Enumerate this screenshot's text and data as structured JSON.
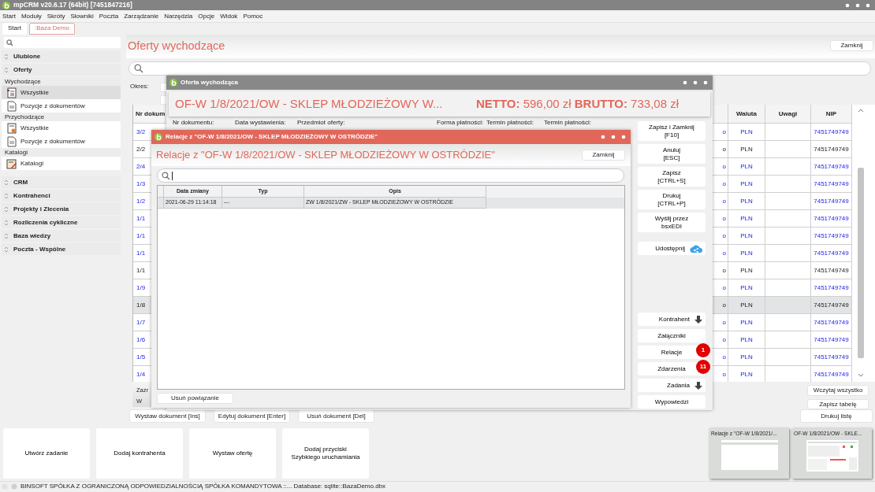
{
  "app": {
    "title": "mpCRM v20.6.17 (64bit) [7451847216]"
  },
  "menu": [
    "Start",
    "Moduły",
    "Skróty",
    "Słowniki",
    "Poczta",
    "Zarządzanie",
    "Narzędzia",
    "Opcje",
    "Widok",
    "Pomoc"
  ],
  "tabs": [
    {
      "label": "Start",
      "selected": false
    },
    {
      "label": ":Baza Demo",
      "selected": true
    }
  ],
  "sidebar": {
    "sections": [
      {
        "label": "Ulubione"
      },
      {
        "label": "Oferty",
        "groups": [
          {
            "label": "Wychodzące",
            "items": [
              {
                "label": "Wszystkie",
                "kind": "list",
                "selected": true
              },
              {
                "label": "Pozycje z dokumentów",
                "kind": "document",
                "selected": false
              }
            ]
          },
          {
            "label": "Przychodzące",
            "items": [
              {
                "label": "Wszystkie",
                "kind": "incoming",
                "selected": false
              },
              {
                "label": "Pozycje z dokumentów",
                "kind": "document",
                "selected": false
              }
            ]
          },
          {
            "label": "Katalogi",
            "items": [
              {
                "label": "Katalogi",
                "kind": "catalog",
                "selected": false
              }
            ]
          }
        ]
      },
      {
        "label": "CRM"
      },
      {
        "label": "Kontrahenci"
      },
      {
        "label": "Projekty i Zlecenia"
      },
      {
        "label": "Rozliczenia cykliczne"
      },
      {
        "label": "Baza wiedzy"
      },
      {
        "label": "Poczta - Wspólne"
      }
    ]
  },
  "content": {
    "title": "Oferty wychodzące",
    "close_button": "Zamknij",
    "period_label": "Okres:",
    "table": {
      "columns": [
        "Nr dokum",
        "Waluta",
        "Uwagi",
        "NIP"
      ],
      "rows": [
        {
          "nr": "3/2",
          "column_2": "o",
          "waluta": "PLN",
          "nip": "7451749749",
          "kind": "link",
          "selected": false
        },
        {
          "nr": "2/2",
          "column_2": "o",
          "waluta": "PLN",
          "nip": "7451749749",
          "kind": "plain",
          "selected": false
        },
        {
          "nr": "2/4",
          "column_2": "o",
          "waluta": "PLN",
          "nip": "7451749749",
          "kind": "link",
          "selected": false
        },
        {
          "nr": "1/3",
          "column_2": "o",
          "waluta": "PLN",
          "nip": "7451749749",
          "kind": "link",
          "selected": false
        },
        {
          "nr": "1/2",
          "column_2": "o",
          "waluta": "PLN",
          "nip": "7451749749",
          "kind": "link",
          "selected": false
        },
        {
          "nr": "1/1",
          "column_2": "o",
          "waluta": "PLN",
          "nip": "7451749749",
          "kind": "link",
          "selected": false
        },
        {
          "nr": "1/1",
          "column_2": "o",
          "waluta": "PLN",
          "nip": "7451749749",
          "kind": "link",
          "selected": false
        },
        {
          "nr": "1/1",
          "column_2": "o",
          "waluta": "PLN",
          "nip": "7451749749",
          "kind": "link",
          "selected": false
        },
        {
          "nr": "1/1",
          "column_2": "o",
          "waluta": "PLN",
          "nip": "7451749749",
          "kind": "plain",
          "selected": false
        },
        {
          "nr": "1/9",
          "column_2": "o",
          "waluta": "PLN",
          "nip": "7451749749",
          "kind": "link",
          "selected": false
        },
        {
          "nr": "1/8",
          "column_2": "o",
          "waluta": "PLN",
          "nip": "7451749749",
          "kind": "plain",
          "selected": true
        },
        {
          "nr": "1/7",
          "column_2": "o",
          "waluta": "PLN",
          "nip": "7451749749",
          "kind": "link",
          "selected": false
        },
        {
          "nr": "1/6",
          "column_2": "o",
          "waluta": "PLN",
          "nip": "7451749749",
          "kind": "link",
          "selected": false
        },
        {
          "nr": "1/5",
          "column_2": "o",
          "waluta": "PLN",
          "nip": "7451749749",
          "kind": "link",
          "selected": false
        },
        {
          "nr": "1/4",
          "column_2": "o",
          "waluta": "PLN",
          "nip": "7451749749",
          "kind": "link",
          "selected": false
        }
      ]
    },
    "footer_texts": [
      "Zazr",
      "W"
    ],
    "table_buttons": [
      "Wczytaj wszystko",
      "Zapisz tabelę"
    ],
    "bottom_buttons": [
      "Wystaw dokument [Ins]",
      "Edytuj dokument [Enter]",
      "Usuń dokument [Del]"
    ],
    "print_button": "Drukuj listę"
  },
  "offer_window": {
    "title": "Oferta wychodząca",
    "heading": "OF-W 1/8/2021/OW - SKLEP MŁODZIEŻOWY W...",
    "totals": "**NETTO:** 596,00 zł **BRUTTO:** 733,08 zł",
    "field_labels": [
      "Nr dokumentu:",
      "Data wystawienia:",
      "Przedmiot oferty:",
      "Forma płatności:",
      "Termin płatności:",
      "Termin płatności:"
    ],
    "button_groups": [
      [
        {
          "label": "Zapisz i Zamknij\n[F10]",
          "kind": "plain"
        },
        {
          "label": "Anuluj\n[ESC]",
          "kind": "plain"
        },
        {
          "label": "Zapisz\n[CTRL+S]",
          "kind": "plain"
        },
        {
          "label": "Drukuj\n[CTRL+P]",
          "kind": "plain"
        },
        {
          "label": "Wyślij przez\nbsxEDI",
          "kind": "plain"
        }
      ],
      [
        {
          "label": "Udostępnij",
          "kind": "share"
        }
      ],
      [
        {
          "label": "Kontrahent",
          "kind": "menu"
        },
        {
          "label": "Załączniki",
          "kind": "plain"
        },
        {
          "label": "Relacje",
          "kind": "plain",
          "badge": "1"
        },
        {
          "label": "Zdarzenia",
          "kind": "plain",
          "badge": "11"
        },
        {
          "label": "Zadania",
          "kind": "menu"
        },
        {
          "label": "Wypowiedzi",
          "kind": "plain"
        }
      ]
    ]
  },
  "relations_window": {
    "title": "Relacje z \"OF-W 1/8/2021/OW - SKLEP MŁODZIEŻOWY W OSTRÓDZIE\"",
    "heading": "Relacje z \"OF-W 1/8/2021/OW - SKLEP MŁODZIEŻOWY W OSTRÓDZIE\"",
    "close_button": "Zamknij",
    "table": {
      "columns": [
        "Data zmiany",
        "Typ",
        "Opis"
      ],
      "rows": [
        {
          "cells": [
            "2021-06-29 11:14:18",
            "---",
            "ZW 1/8/2021/ZW - SKLEP MŁODZIEŻOWY W OSTRÓDZIE"
          ],
          "selected": true
        }
      ]
    },
    "remove_button": "Usuń powiązanie"
  },
  "quick_buttons": [
    "Utwórz zadanie",
    "Dodaj kontrahenta",
    "Wystaw ofertę",
    "Dodaj przyciski\nSzybkiego uruchamiania"
  ],
  "taskbar": [
    {
      "title": "Relacje z \"OF-W 1/8/2021/...",
      "kind": "blank"
    },
    {
      "title": "OF-W 1/8/2021/OW - SKLE...",
      "kind": "form"
    }
  ],
  "status_bar": "BINSOFT SPÓŁKA Z OGRANICZONĄ ODPOWIEDZIALNOŚCIĄ SPÓŁKA KOMANDYTOWA ::... Database: sqlite::BazaDemo.dbx"
}
